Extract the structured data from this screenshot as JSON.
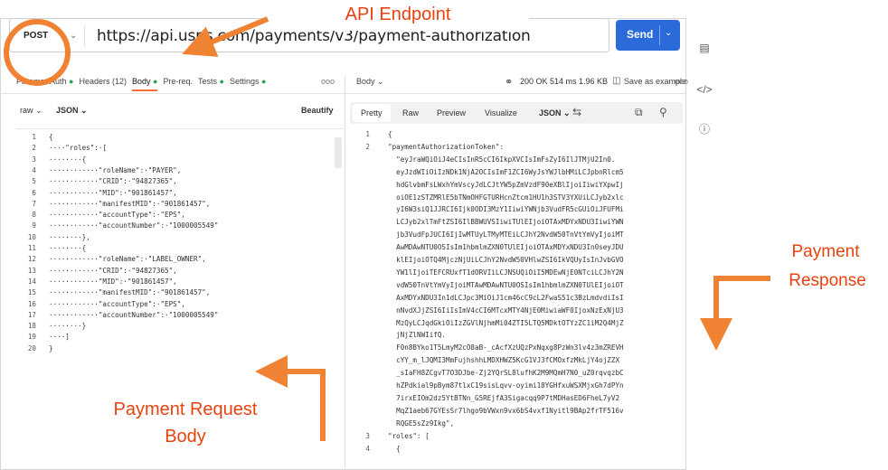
{
  "annotations": {
    "api_endpoint": "API Endpoint",
    "payment_response_line1": "Payment",
    "payment_response_line2": "Response",
    "payment_request_line1": "Payment Request",
    "payment_request_line2": "Body"
  },
  "request": {
    "method": "POST",
    "url": "https://api.usps.com/payments/v3/payment-authorization",
    "send_label": "Send",
    "tabs": [
      {
        "label": "Params",
        "dot": false
      },
      {
        "label": "Auth",
        "dot": true
      },
      {
        "label": "Headers (12)",
        "dot": false
      },
      {
        "label": "Body",
        "dot": true,
        "active": true
      },
      {
        "label": "Pre-req.",
        "dot": false
      },
      {
        "label": "Tests",
        "dot": true
      },
      {
        "label": "Settings",
        "dot": true
      }
    ],
    "more": "ooo",
    "body_type": "raw",
    "body_format": "JSON",
    "beautify_label": "Beautify",
    "body_lines": [
      "{",
      "····\"roles\":·[",
      "········{",
      "············\"roleName\":·\"PAYER\",",
      "············\"CRID\":·\"94827365\",",
      "············\"MID\":·\"901861457\",",
      "············\"manifestMID\":·\"901861457\",",
      "············\"accountType\":·\"EPS\",",
      "············\"accountNumber\":·\"1000005549\"",
      "········},",
      "········{",
      "············\"roleName\":·\"LABEL_OWNER\",",
      "············\"CRID\":·\"94827365\",",
      "············\"MID\":·\"901861457\",",
      "············\"manifestMID\":·\"901861457\",",
      "············\"accountType\":·\"EPS\",",
      "············\"accountNumber\":·\"1000005549\"",
      "········}",
      "····]",
      "}"
    ]
  },
  "response": {
    "body_label": "Body",
    "status": "200 OK  514 ms  1.96 KB",
    "save_label": "Save as example",
    "more": "ooo",
    "view_tabs": [
      "Pretty",
      "Raw",
      "Preview",
      "Visualize"
    ],
    "format": "JSON",
    "lines": [
      {
        "n": "1",
        "t": "{"
      },
      {
        "n": "2",
        "t": "\"paymentAuthorizationToken\":"
      },
      {
        "n": "",
        "t": "  \"eyJraWQiOiJ4eCIsInR5cCI6IkpXVCIsImFsZyI6IlJTMjU2In0."
      },
      {
        "n": "",
        "t": "  eyJzdWIiOiIzNDk1NjA2OCIsImF1ZCI6WyJsYWJlbHMiLCJpbnRlcm5"
      },
      {
        "n": "",
        "t": "  hdGlvbmFsLWxhYmVscyJdLCJtYW5pZmVzdF90eXBlIjoiIiwiYXpwIj"
      },
      {
        "n": "",
        "t": "  oiOE1zSTZMRlE5bTNmOHFGTURHcnZtcm1HU1h3STV3YXUiLCJyb2xlc"
      },
      {
        "n": "",
        "t": "  yI6W3siQ1JJRCI6Ijk0ODI3MzY1IiwiYWNjb3VudFR5cGUiOiJFUFMi"
      },
      {
        "n": "",
        "t": "  LCJyb2xlTmFtZSI6IlBBWUVSIiwiTUlEIjoiOTAxMDYxNDU3IiwiYWN"
      },
      {
        "n": "",
        "t": "  jb3VudFpJUCI6IjIwMTUyLTMyMTEiLCJhY2NvdW50TnVtYmVyIjoiMT"
      },
      {
        "n": "",
        "t": "  AwMDAwNTU0OSIsIm1hbmlmZXN0TUlEIjoiOTAxMDYxNDU3In0seyJDU"
      },
      {
        "n": "",
        "t": "  klEIjoiOTQ4MjczNjUiLCJhY2NvdW50VHlwZSI6IkVQUyIsInJvbGVO"
      },
      {
        "n": "",
        "t": "  YW1lIjoiTEFCRUxfT1dORVIiLCJNSUQiOiI5MDEwNjE0NTciLCJhY2N"
      },
      {
        "n": "",
        "t": "  vdW50TnVtYmVyIjoiMTAwMDAwNTU0OSIsIm1hbmlmZXN0TUlEIjoiOT"
      },
      {
        "n": "",
        "t": "  AxMDYxNDU3In1dLCJpc3MiOiJ1cm46cC9cL2FwaS51c3BzLmdvdiIsI"
      },
      {
        "n": "",
        "t": "  nNvdXJjZSI6IiIsImV4cCI6MTcxMTY4NjE0MiwiaWF0IjoxNzExNjU3"
      },
      {
        "n": "",
        "t": "  MzQyLCJqdGkiOiIzZGVlNjhmMi04ZTI5LTQ5MDktOTYzZC1iM2Q4MjZ"
      },
      {
        "n": "",
        "t": "  jNjZlNWIifQ."
      },
      {
        "n": "",
        "t": "  F0n8BYko1T5LmyM2cO8aB-_cAcfXzUQzPxNqxg8PzWn3lv4z3mZREVH"
      },
      {
        "n": "",
        "t": "  cYY_m_lJQMI3MmFujhshhLMDXHWZ5KcG1VJ3fCMOxfzMkLjY4ojZZX"
      },
      {
        "n": "",
        "t": "  _sIaFH8ZCgvT7O3DJbe-Zj2YQrSL8lufhK2M9MQmH7N0_uZ0rqvqzbC"
      },
      {
        "n": "",
        "t": "  hZPdkial9pBym87tlxC19sisLqvv-oyimi18YGHfxuWSXMjxGh7dPYn"
      },
      {
        "n": "",
        "t": "  7irxEIOm2dz5YtBTNn_G5REjfA3Sigacqq9P7tMDHasED6FheL7yV2"
      },
      {
        "n": "",
        "t": "  MqZ1aeb67GYEsSr7lhgo9bVWxn9vx6bS4vxf1Nyitl9BAp2frTF516v"
      },
      {
        "n": "",
        "t": "  RQGE5sZz9Ikg\","
      },
      {
        "n": "3",
        "t": "\"roles\": ["
      },
      {
        "n": "4",
        "t": "  {"
      }
    ]
  },
  "rail_icons": [
    "document-icon",
    "code-icon",
    "info-icon"
  ]
}
